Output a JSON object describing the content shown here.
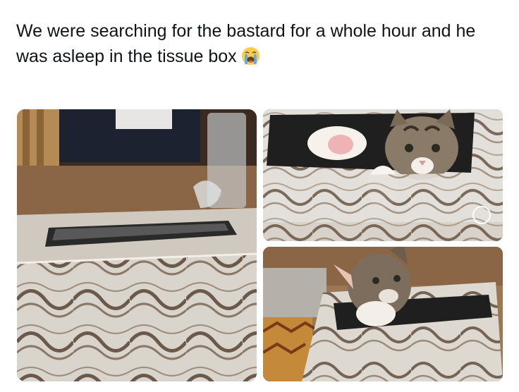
{
  "post": {
    "text": "We were searching for the bastard for a whole hour and he was asleep in the tissue box",
    "emoji": "loudly-crying-face"
  },
  "photos": [
    {
      "subject": "empty-tissue-box"
    },
    {
      "subject": "kitten-in-tissue-box"
    },
    {
      "subject": "kitten-peeking-from-tissue-box"
    }
  ]
}
